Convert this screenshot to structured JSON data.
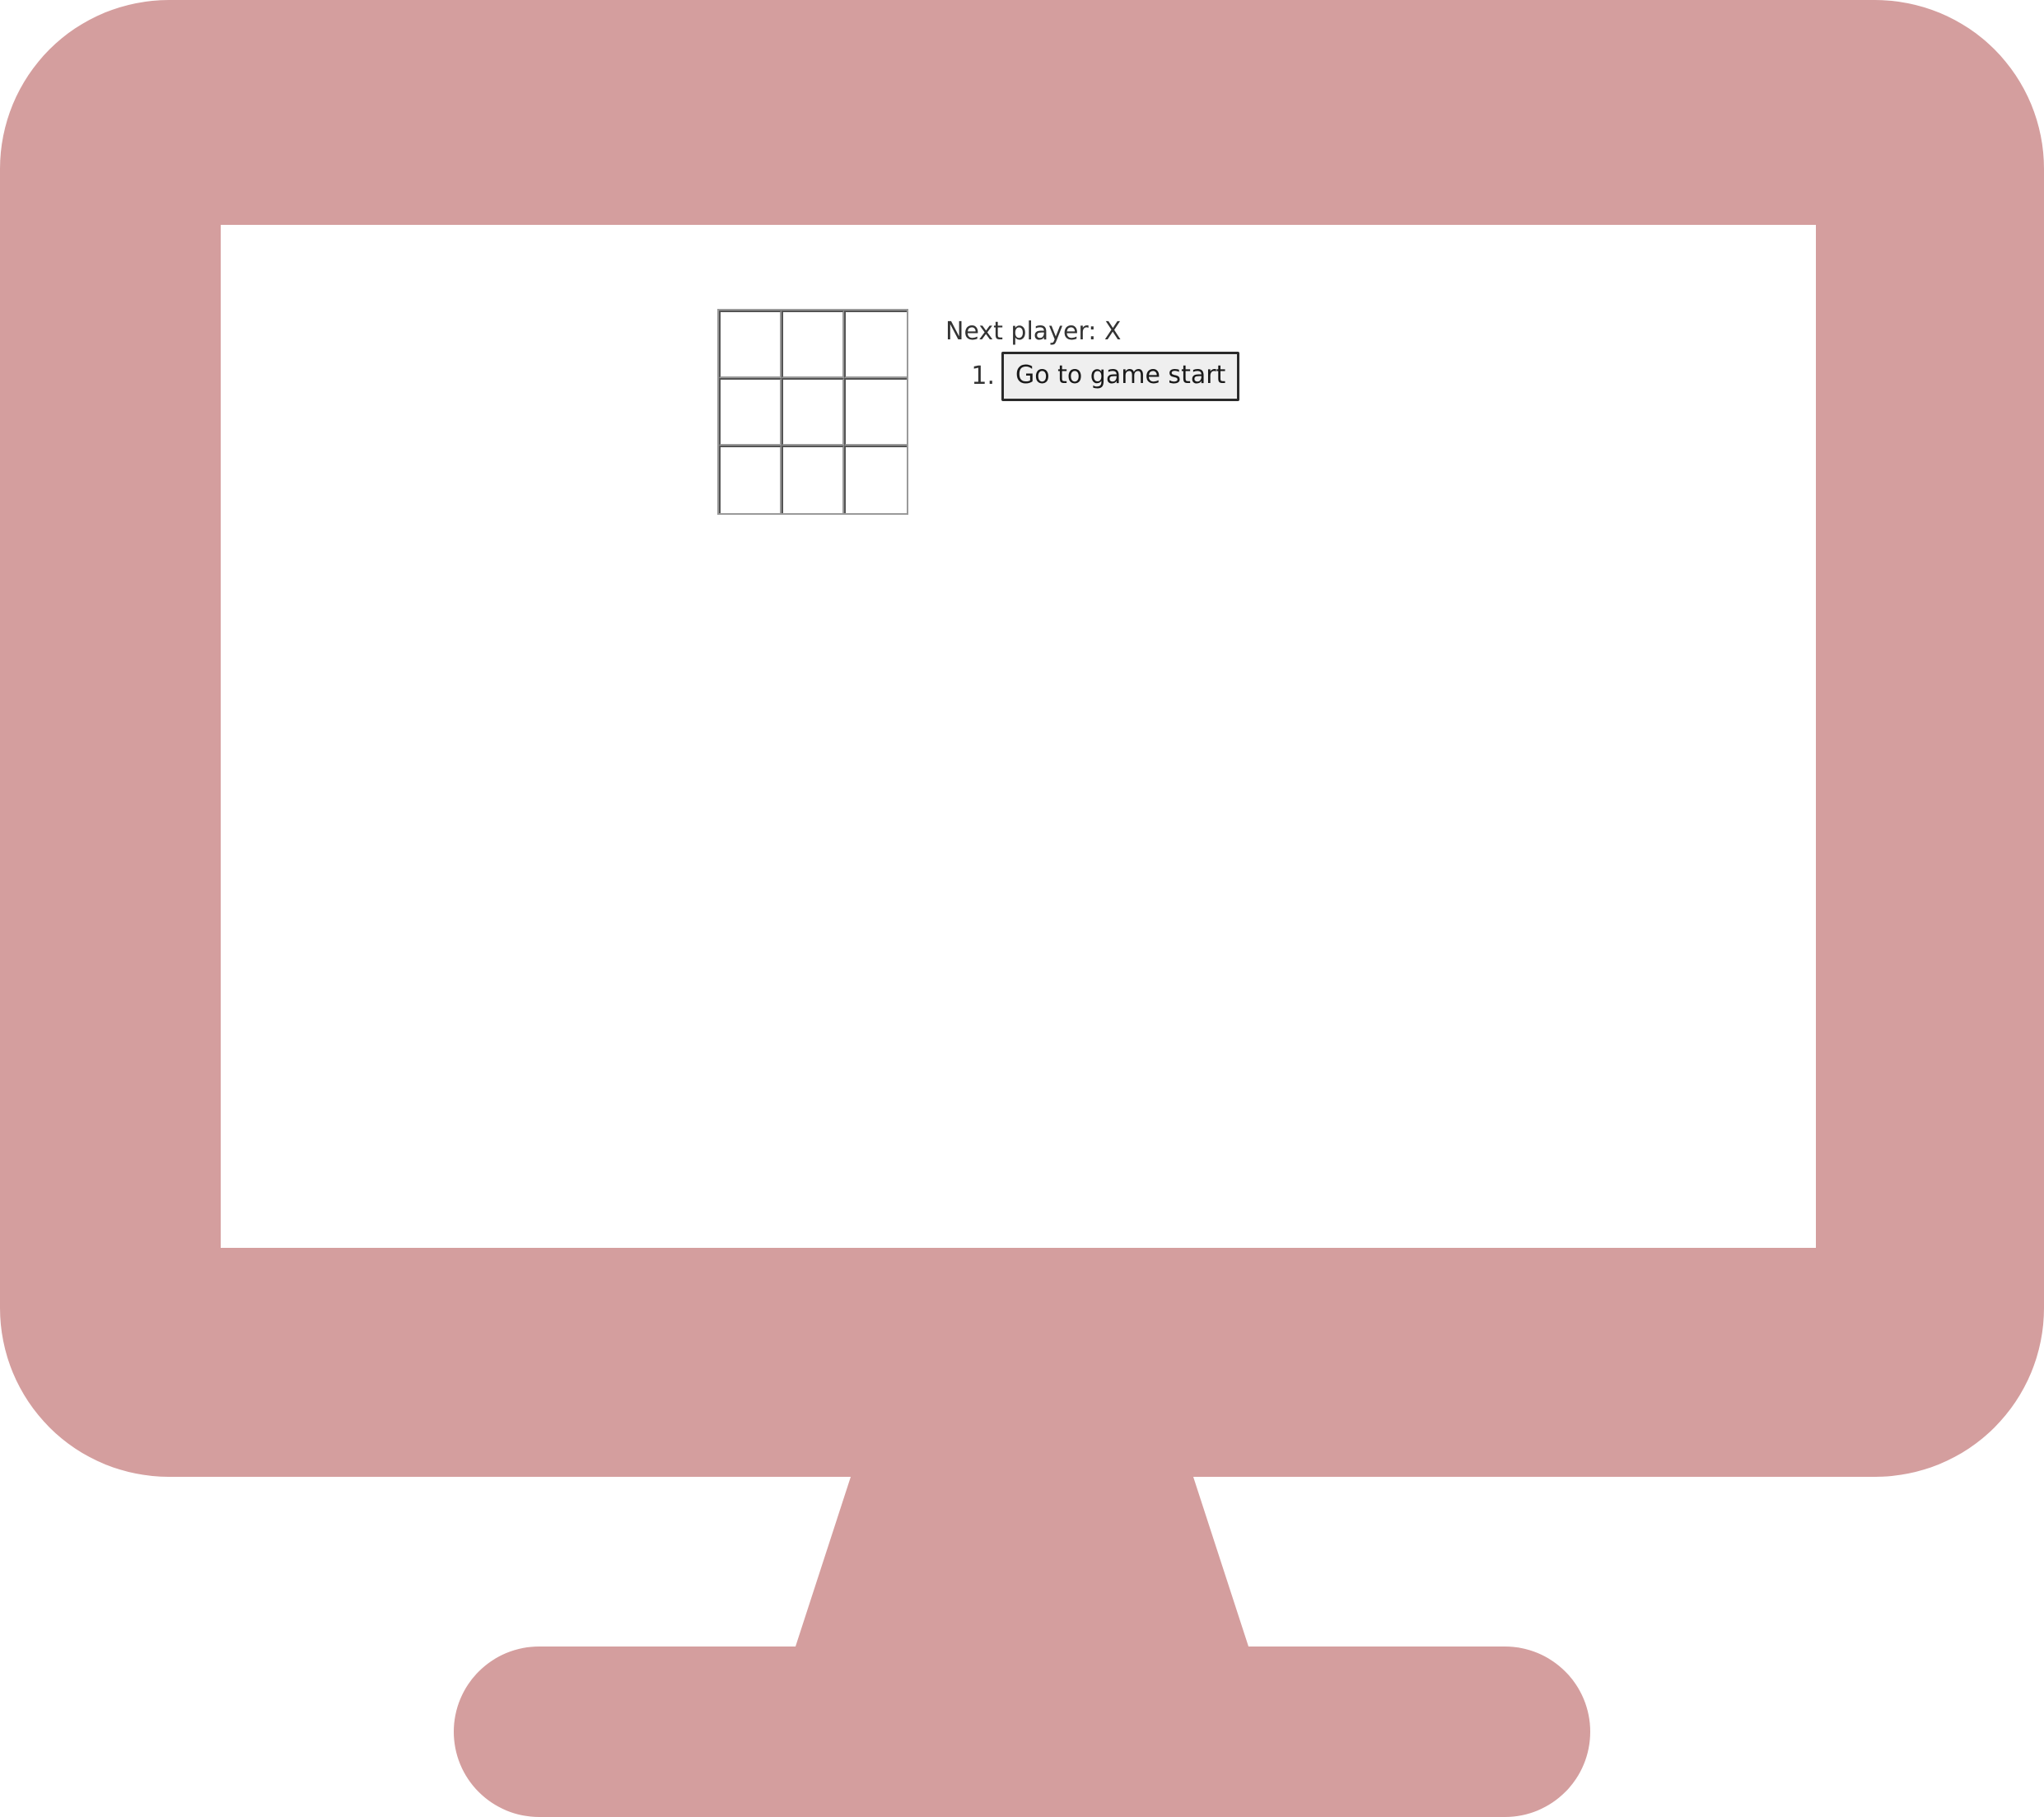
{
  "colors": {
    "monitor": "#d49e9e",
    "screen": "#ffffff",
    "grid": "#9a9a9a",
    "text": "#333333"
  },
  "icon": "monitor-icon",
  "game": {
    "squares": [
      "",
      "",
      "",
      "",
      "",
      "",
      "",
      "",
      ""
    ],
    "status": "Next player: X",
    "moves": [
      {
        "number": "1.",
        "label": "Go to game start"
      }
    ]
  }
}
